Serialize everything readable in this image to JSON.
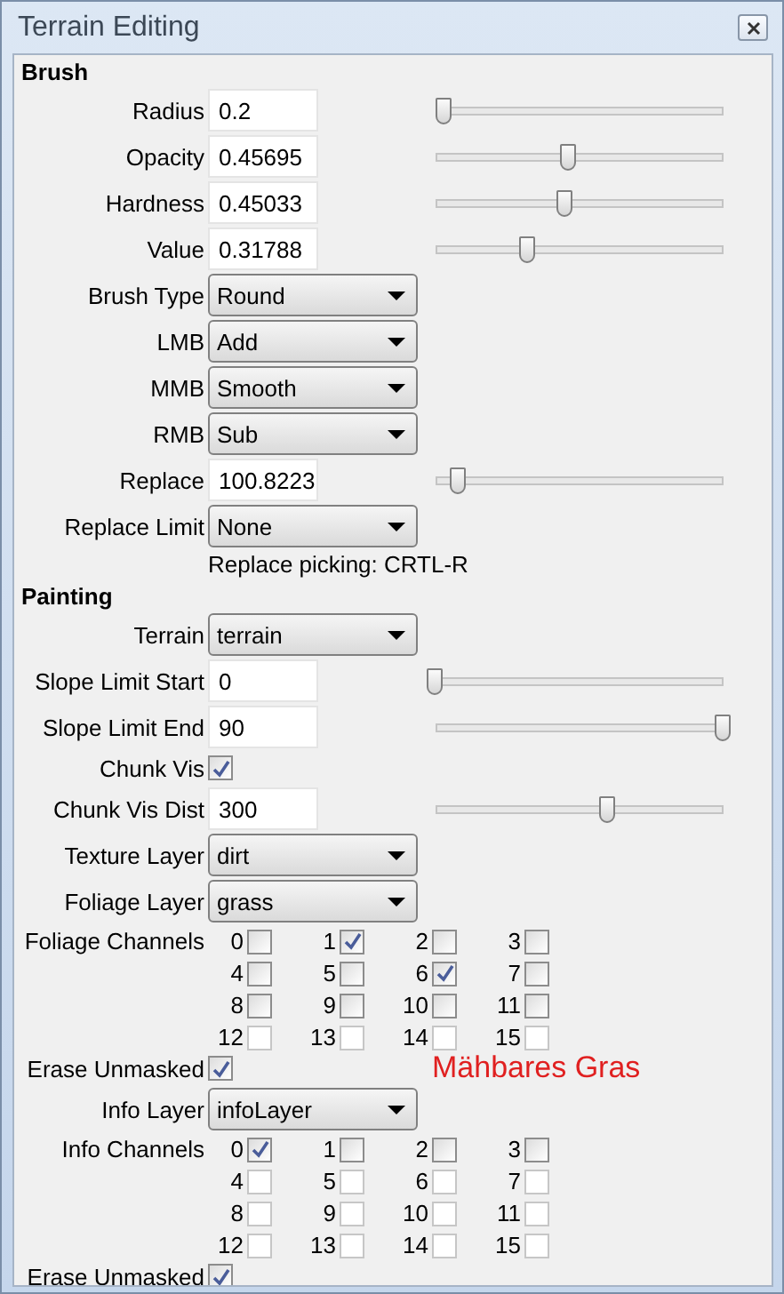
{
  "window": {
    "title": "Terrain Editing"
  },
  "sections": [
    {
      "heading": "Brush",
      "rows": [
        {
          "kind": "number",
          "label": "Radius",
          "value": "0.2",
          "level": 0.03
        },
        {
          "kind": "number",
          "label": "Opacity",
          "value": "0.45695",
          "level": 0.46
        },
        {
          "kind": "number",
          "label": "Hardness",
          "value": "0.45033",
          "level": 0.45
        },
        {
          "kind": "number",
          "label": "Value",
          "value": "0.31788",
          "level": 0.32
        },
        {
          "kind": "dropdown",
          "label": "Brush Type",
          "value": "Round"
        },
        {
          "kind": "dropdown",
          "label": "LMB",
          "value": "Add"
        },
        {
          "kind": "dropdown",
          "label": "MMB",
          "value": "Smooth"
        },
        {
          "kind": "dropdown",
          "label": "RMB",
          "value": "Sub"
        },
        {
          "kind": "number",
          "label": "Replace",
          "value": "100.8223",
          "level": 0.08
        },
        {
          "kind": "dropdown",
          "label": "Replace Limit",
          "value": "None"
        },
        {
          "kind": "note",
          "text": "Replace picking: CRTL-R"
        }
      ]
    },
    {
      "heading": "Painting",
      "rows": [
        {
          "kind": "dropdown",
          "label": "Terrain",
          "value": "terrain"
        },
        {
          "kind": "number",
          "label": "Slope Limit Start",
          "value": "0",
          "level": 0
        },
        {
          "kind": "number",
          "label": "Slope Limit End",
          "value": "90",
          "level": 1
        },
        {
          "kind": "checkbox",
          "label": "Chunk Vis",
          "checked": true
        },
        {
          "kind": "number",
          "label": "Chunk Vis Dist",
          "value": "300",
          "level": 0.6
        },
        {
          "kind": "dropdown",
          "label": "Texture Layer",
          "value": "dirt"
        },
        {
          "kind": "dropdown",
          "label": "Foliage Layer",
          "value": "grass"
        },
        {
          "kind": "channels",
          "label": "Foliage Channels",
          "channels": [
            {
              "label": "0",
              "checked": false,
              "disabled": false
            },
            {
              "label": "1",
              "checked": true,
              "disabled": false
            },
            {
              "label": "2",
              "checked": false,
              "disabled": false
            },
            {
              "label": "3",
              "checked": false,
              "disabled": false
            },
            {
              "label": "4",
              "checked": false,
              "disabled": false
            },
            {
              "label": "5",
              "checked": false,
              "disabled": false
            },
            {
              "label": "6",
              "checked": true,
              "disabled": false
            },
            {
              "label": "7",
              "checked": false,
              "disabled": false
            },
            {
              "label": "8",
              "checked": false,
              "disabled": false
            },
            {
              "label": "9",
              "checked": false,
              "disabled": false
            },
            {
              "label": "10",
              "checked": false,
              "disabled": false
            },
            {
              "label": "11",
              "checked": false,
              "disabled": false
            },
            {
              "label": "12",
              "checked": false,
              "disabled": true
            },
            {
              "label": "13",
              "checked": false,
              "disabled": true
            },
            {
              "label": "14",
              "checked": false,
              "disabled": true
            },
            {
              "label": "15",
              "checked": false,
              "disabled": true
            }
          ]
        },
        {
          "kind": "checkbox",
          "label": "Erase Unmasked",
          "checked": true,
          "annotation": "Mähbares Gras"
        },
        {
          "kind": "dropdown",
          "label": "Info Layer",
          "value": "infoLayer"
        },
        {
          "kind": "channels",
          "label": "Info Channels",
          "channels": [
            {
              "label": "0",
              "checked": true,
              "disabled": false
            },
            {
              "label": "1",
              "checked": false,
              "disabled": false
            },
            {
              "label": "2",
              "checked": false,
              "disabled": false
            },
            {
              "label": "3",
              "checked": false,
              "disabled": false
            },
            {
              "label": "4",
              "checked": false,
              "disabled": true
            },
            {
              "label": "5",
              "checked": false,
              "disabled": true
            },
            {
              "label": "6",
              "checked": false,
              "disabled": true
            },
            {
              "label": "7",
              "checked": false,
              "disabled": true
            },
            {
              "label": "8",
              "checked": false,
              "disabled": true
            },
            {
              "label": "9",
              "checked": false,
              "disabled": true
            },
            {
              "label": "10",
              "checked": false,
              "disabled": true
            },
            {
              "label": "11",
              "checked": false,
              "disabled": true
            },
            {
              "label": "12",
              "checked": false,
              "disabled": true
            },
            {
              "label": "13",
              "checked": false,
              "disabled": true
            },
            {
              "label": "14",
              "checked": false,
              "disabled": true
            },
            {
              "label": "15",
              "checked": false,
              "disabled": true
            }
          ]
        },
        {
          "kind": "checkbox",
          "label": "Erase Unmasked",
          "checked": true
        }
      ]
    }
  ]
}
